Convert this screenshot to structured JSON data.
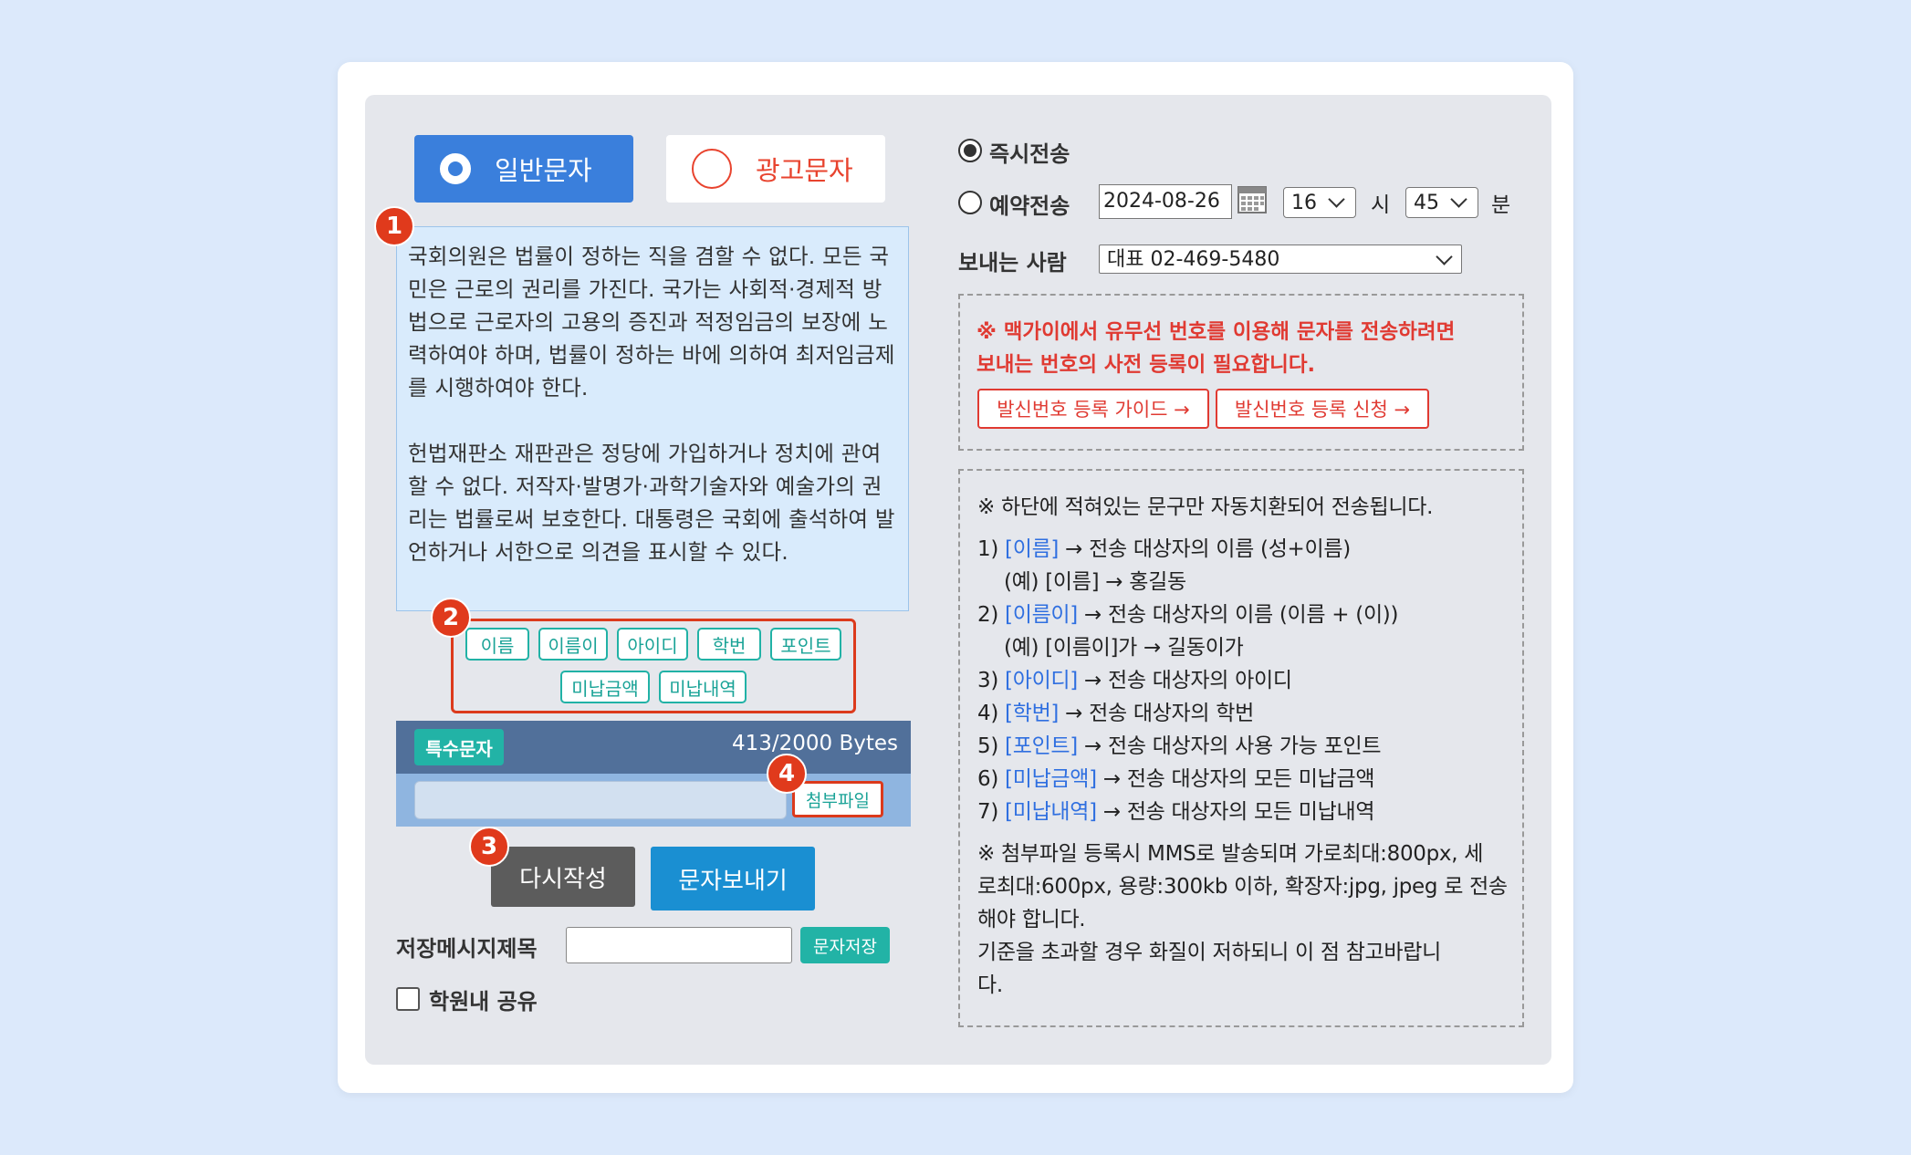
{
  "message_type": {
    "normal_label": "일반문자",
    "ad_label": "광고문자"
  },
  "message_text": "국회의원은 법률이 정하는 직을 겸할 수 없다. 모든 국민은 근로의 권리를 가진다. 국가는 사회적·경제적 방법으로 근로자의 고용의 증진과 적정임금의 보장에 노력하여야 하며, 법률이 정하는 바에 의하여 최저임금제를 시행하여야 한다.\n\n헌법재판소 재판관은 정당에 가입하거나 정치에 관여할 수 없다. 저작자·발명가·과학기술자와 예술가의 권리는 법률로써 보호한다. 대통령은 국회에 출석하여 발언하거나 서한으로 의견을 표시할 수 있다.",
  "badges": [
    "1",
    "2",
    "3",
    "4"
  ],
  "tags": [
    "이름",
    "이름이",
    "아이디",
    "학번",
    "포인트",
    "미납금액",
    "미납내역"
  ],
  "special_chars_label": "특수문자",
  "byte_count": "413/2000 Bytes",
  "attach_label": "첨부파일",
  "reset_label": "다시작성",
  "send_label": "문자보내기",
  "save_title_label": "저장메시지제목",
  "save_button_label": "문자저장",
  "share_label": "학원내 공유",
  "send_mode": {
    "immediate_label": "즉시전송",
    "scheduled_label": "예약전송",
    "date": "2024-08-26",
    "hour": "16",
    "hour_unit": "시",
    "minute": "45",
    "minute_unit": "분"
  },
  "sender": {
    "label": "보내는 사람",
    "value": "대표 02-469-5480"
  },
  "warning": {
    "line1": "※ 맥가이에서 유무선 번호를 이용해 문자를 전송하려면",
    "line2": "보내는 번호의 사전 등록이 필요합니다.",
    "guide_button": "발신번호 등록 가이드 →",
    "apply_button": "발신번호 등록 신청 →"
  },
  "info": {
    "header": "※ 하단에 적혀있는 문구만 자동치환되어 전송됩니다.",
    "items": [
      {
        "num": "1)",
        "var": "[이름]",
        "desc": "→ 전송 대상자의 이름 (성+이름)"
      },
      {
        "example": "(예) [이름] → 홍길동"
      },
      {
        "num": "2)",
        "var": "[이름이]",
        "desc": "→ 전송 대상자의 이름 (이름 + (이))"
      },
      {
        "example": "(예) [이름이]가 → 길동이가"
      },
      {
        "num": "3)",
        "var": "[아이디]",
        "desc": "→ 전송 대상자의 아이디"
      },
      {
        "num": "4)",
        "var": "[학번]",
        "desc": "→ 전송 대상자의 학번"
      },
      {
        "num": "5)",
        "var": "[포인트]",
        "desc": "→ 전송 대상자의 사용 가능 포인트"
      },
      {
        "num": "6)",
        "var": "[미납금액]",
        "desc": "→ 전송 대상자의 모든 미납금액"
      },
      {
        "num": "7)",
        "var": "[미납내역]",
        "desc": "→ 전송 대상자의 모든 미납내역"
      }
    ],
    "footer_lines": [
      "※ 첨부파일 등록시 MMS로 발송되며 가로최대:800px, 세",
      "로최대:600px, 용량:300kb 이하, 확장자:jpg, jpeg 로 전송",
      "해야 합니다.",
      "기준을 초과할 경우 화질이 저하되니 이 점 참고바랍니",
      "다."
    ]
  },
  "colors": {
    "background": "#dce9fb",
    "accent_blue": "#3a7fdc",
    "accent_red": "#e03a1c",
    "teal": "#22b3a6",
    "send_blue": "#1a8fd2"
  },
  "icons": [
    "radio-checked-icon",
    "radio-unchecked-icon",
    "calendar-icon",
    "chevron-down-icon",
    "checkbox-icon"
  ]
}
